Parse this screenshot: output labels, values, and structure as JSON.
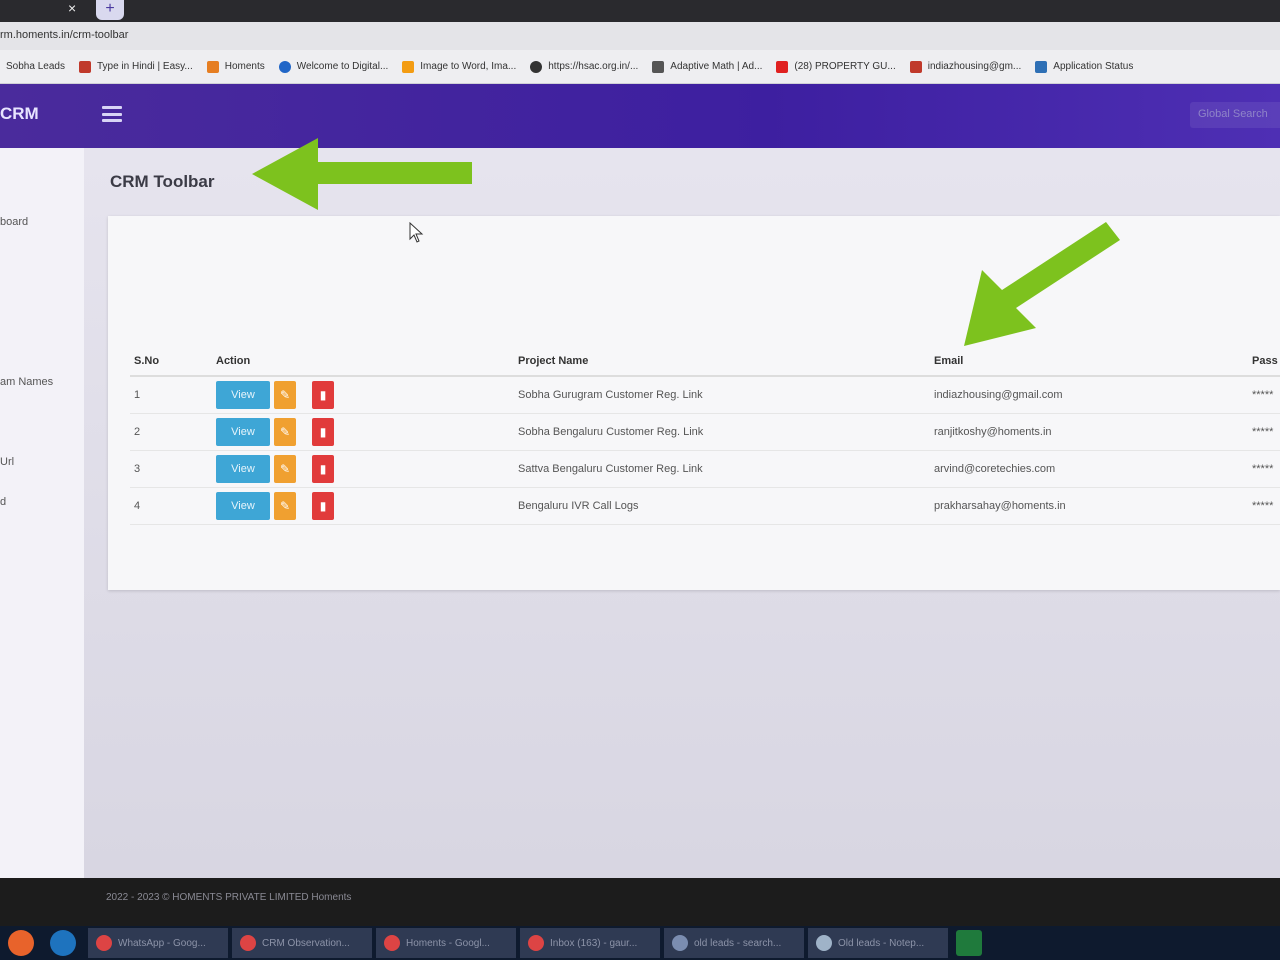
{
  "browser": {
    "url": "rm.homents.in/crm-toolbar",
    "new_tab": "+",
    "tab_close": "×",
    "bookmarks": [
      {
        "label": "Sobha Leads",
        "icon": "",
        "color": "#3b7bd8"
      },
      {
        "label": "Type in Hindi | Easy...",
        "icon": "bookmark-icon",
        "color": "#c0392b"
      },
      {
        "label": "Homents",
        "icon": "bookmark-icon",
        "color": "#e67e22"
      },
      {
        "label": "Welcome to Digital...",
        "icon": "bookmark-icon",
        "color": "#2166c7"
      },
      {
        "label": "Image to Word, Ima...",
        "icon": "bookmark-icon",
        "color": "#f39c12"
      },
      {
        "label": "https://hsac.org.in/...",
        "icon": "globe-icon",
        "color": "#333333"
      },
      {
        "label": "Adaptive Math | Ad...",
        "icon": "bookmark-icon",
        "color": "#555555"
      },
      {
        "label": "(28) PROPERTY GU...",
        "icon": "youtube-icon",
        "color": "#e02020"
      },
      {
        "label": "indiazhousing@gm...",
        "icon": "gmail-icon",
        "color": "#c0392b"
      },
      {
        "label": "Application Status",
        "icon": "bookmark-icon",
        "color": "#2e6fb5"
      }
    ]
  },
  "header": {
    "brand": "CRM",
    "search_placeholder": "Global Search"
  },
  "sidebar": {
    "items": [
      "board",
      "",
      "am Names",
      "Url",
      "d"
    ]
  },
  "page": {
    "title": "CRM Toolbar"
  },
  "table": {
    "columns": [
      "S.No",
      "Action",
      "Project Name",
      "Email",
      "Pass"
    ],
    "view_label": "View",
    "rows": [
      {
        "sno": "1",
        "project": "Sobha Gurugram Customer Reg. Link",
        "email": "indiazhousing@gmail.com",
        "pass": "*****"
      },
      {
        "sno": "2",
        "project": "Sobha Bengaluru Customer Reg. Link",
        "email": "ranjitkoshy@homents.in",
        "pass": "*****"
      },
      {
        "sno": "3",
        "project": "Sattva Bengaluru Customer Reg. Link",
        "email": "arvind@coretechies.com",
        "pass": "*****"
      },
      {
        "sno": "4",
        "project": "Bengaluru IVR Call Logs",
        "email": "prakharsahay@homents.in",
        "pass": "*****"
      }
    ]
  },
  "footer": {
    "text": "2022 - 2023 © HOMENTS PRIVATE LIMITED Homents"
  },
  "taskbar": {
    "items": [
      "WhatsApp - Goog...",
      "CRM Observation...",
      "Homents - Googl...",
      "Inbox (163) - gaur...",
      "old leads - search...",
      "Old leads - Notep..."
    ]
  },
  "colors": {
    "header": "#4a2b9c",
    "view_button": "#3ea6d6",
    "edit_button": "#f0a030",
    "delete_button": "#e13b3b",
    "annotation_arrow": "#7dc21e"
  }
}
